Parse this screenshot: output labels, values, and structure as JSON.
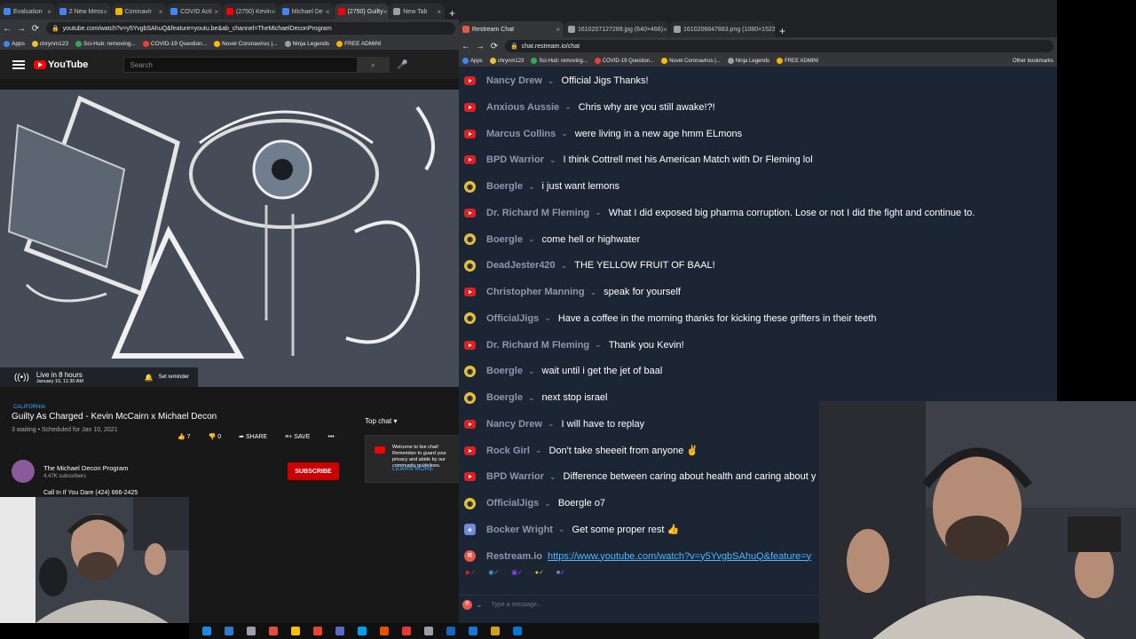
{
  "left_browser": {
    "tabs": [
      {
        "label": "Evaluation",
        "color": "#4285f4",
        "active": false
      },
      {
        "label": "2 New Mess",
        "color": "#4285f4",
        "active": false
      },
      {
        "label": "Coronavir",
        "color": "#f4b400",
        "active": false
      },
      {
        "label": "COVID Acti",
        "color": "#4285f4",
        "active": false
      },
      {
        "label": "(2750) Kevin",
        "color": "#ff0000",
        "active": false
      },
      {
        "label": "Michael De",
        "color": "#4285f4",
        "active": false
      },
      {
        "label": "(2750) Guilty",
        "color": "#ff0000",
        "active": true
      },
      {
        "label": "New Tab",
        "color": "#9aa0a6",
        "active": false
      }
    ],
    "url": "youtube.com/watch?v=y5YvgbSAhuQ&feature=youtu.be&ab_channel=TheMichaelDeconProgram",
    "bookmarks": [
      "Apps",
      "chrynm123",
      "Sci-Hub: removing...",
      "COVID-19 Question...",
      "Novel Coronavirus |...",
      "Ninja Legends",
      "FREE ADMIN!"
    ],
    "search_placeholder": "Search",
    "logo": "YouTube",
    "player": {
      "live_line": "Live in 8 hours",
      "live_date": "January 10, 11:30 AM",
      "reminder": "Set reminder"
    },
    "video": {
      "location": "CALIFORNIA",
      "title": "Guilty As Charged - Kevin McCairn x Michael Decon",
      "meta": "3 waiting • Scheduled for Jan 10, 2021",
      "likes": "7",
      "dislikes": "0",
      "share": "SHARE",
      "save": "SAVE"
    },
    "channel": {
      "name": "The Michael Decon Program",
      "subs": "4.47K subscribers",
      "subscribe": "SUBSCRIBE"
    },
    "description": "Call In If You Dare (424) 666-2425",
    "chat": {
      "top_chat": "Top chat",
      "welcome": "Welcome to live chat! Remember to guard your privacy and abide by our community guidelines.",
      "learn_more": "LEARN MORE"
    }
  },
  "right_browser": {
    "tabs": [
      {
        "label": "Restream Chat",
        "active": true
      },
      {
        "label": "1610207127289.jpg (640×466)",
        "active": false
      },
      {
        "label": "1610206847883.png (1080×1523)",
        "active": false
      }
    ],
    "url": "chat.restream.io/chat",
    "bookmarks": [
      "Apps",
      "chrynm123",
      "Sci-Hub: removing...",
      "COVID-19 Question...",
      "Novel Coronavirus |...",
      "Ninja Legends",
      "FREE ADMIN!"
    ],
    "other_bookmarks": "Other bookmarks",
    "messages": [
      {
        "platform": "youtube",
        "user": "Nancy Drew",
        "text": "Official Jigs Thanks!"
      },
      {
        "platform": "youtube",
        "user": "Anxious Aussie",
        "text": "Chris why are you still awake!?!"
      },
      {
        "platform": "youtube",
        "user": "Marcus Collins",
        "text": "were living in a new age hmm ELmons"
      },
      {
        "platform": "youtube",
        "user": "BPD Warrior",
        "text": "I think Cottrell met his American Match with Dr Fleming lol"
      },
      {
        "platform": "twitch",
        "user": "Boergle",
        "text": "i just want lemons"
      },
      {
        "platform": "youtube",
        "user": "Dr. Richard M Fleming",
        "text": "What I did exposed big pharma corruption. Lose or not I did the fight and continue to."
      },
      {
        "platform": "twitch",
        "user": "Boergle",
        "text": "come hell or highwater"
      },
      {
        "platform": "twitch",
        "user": "DeadJester420",
        "text": "THE YELLOW FRUIT OF BAAL!"
      },
      {
        "platform": "youtube",
        "user": "Christopher Manning",
        "text": "speak for yourself"
      },
      {
        "platform": "twitch",
        "user": "OfficialJigs",
        "text": "Have a coffee in the morning thanks for kicking these grifters in their teeth"
      },
      {
        "platform": "youtube",
        "user": "Dr. Richard M Fleming",
        "text": "Thank you Kevin!"
      },
      {
        "platform": "twitch",
        "user": "Boergle",
        "text": "wait until i get the jet of baal"
      },
      {
        "platform": "twitch",
        "user": "Boergle",
        "text": "next stop israel"
      },
      {
        "platform": "youtube",
        "user": "Nancy Drew",
        "text": "I will have to replay"
      },
      {
        "platform": "youtube",
        "user": "Rock Girl",
        "text": "Don't take sheeeit from anyone ✌"
      },
      {
        "platform": "youtube",
        "user": "BPD Warrior",
        "text": "Difference between caring about health and caring about y"
      },
      {
        "platform": "twitch",
        "user": "OfficialJigs",
        "text": "Boergle o7"
      },
      {
        "platform": "discord",
        "user": "Bocker Wright",
        "text": "Get some proper rest 👍"
      },
      {
        "platform": "restream",
        "user": "Restream.io",
        "text": "",
        "link": "https://www.youtube.com/watch?v=y5YvgbSAhuQ&feature=y"
      }
    ],
    "composer_placeholder": "Type a message..."
  }
}
